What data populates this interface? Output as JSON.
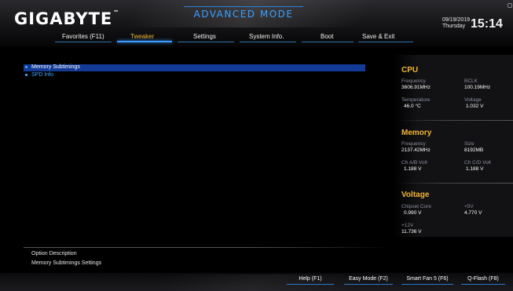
{
  "header": {
    "logo": "GIGABYTE",
    "logo_tm": "™",
    "mode_title": "ADVANCED MODE",
    "date": "09/19/2019",
    "day": "Thursday",
    "time": "15:14"
  },
  "nav": {
    "tabs": [
      {
        "label": "Favorites (F11)",
        "active": false
      },
      {
        "label": "Tweaker",
        "active": true
      },
      {
        "label": "Settings",
        "active": false
      },
      {
        "label": "System Info.",
        "active": false
      },
      {
        "label": "Boot",
        "active": false
      },
      {
        "label": "Save & Exit",
        "active": false
      }
    ]
  },
  "menu": {
    "items": [
      {
        "label": "Memory Subtimings",
        "selected": true
      },
      {
        "label": "SPD Info",
        "selected": false
      }
    ]
  },
  "cpu": {
    "title": "CPU",
    "frequency_label": "Frequency",
    "frequency_value": "3606.91MHz",
    "bclk_label": "BCLK",
    "bclk_value": "100.19MHz",
    "temperature_label": "Temperature",
    "temperature_value": "46.0 °C",
    "voltage_label": "Voltage",
    "voltage_value": "1.032 V"
  },
  "memory": {
    "title": "Memory",
    "frequency_label": "Frequency",
    "frequency_value": "2137.42MHz",
    "size_label": "Size",
    "size_value": "8192MB",
    "chab_label": "Ch A/B Volt",
    "chab_value": "1.188 V",
    "chcd_label": "Ch C/D Volt",
    "chcd_value": "1.188 V"
  },
  "voltage": {
    "title": "Voltage",
    "chipset_label": "Chipset Core",
    "chipset_value": "0.990 V",
    "v5_label": "+5V",
    "v5_value": "4.770 V",
    "v12_label": "+12V",
    "v12_value": "11.736 V"
  },
  "description": {
    "title": "Option Description",
    "text": "Memory Subtimings Settings"
  },
  "footer": {
    "buttons": [
      {
        "label": "Help (F1)"
      },
      {
        "label": "Easy Mode (F2)"
      },
      {
        "label": "Smart Fan 5 (F6)"
      },
      {
        "label": "Q-Flash (F8)"
      }
    ]
  },
  "colors": {
    "accent_blue": "#3aa0ff",
    "accent_orange": "#f2b636",
    "selection_blue": "#123a96"
  }
}
